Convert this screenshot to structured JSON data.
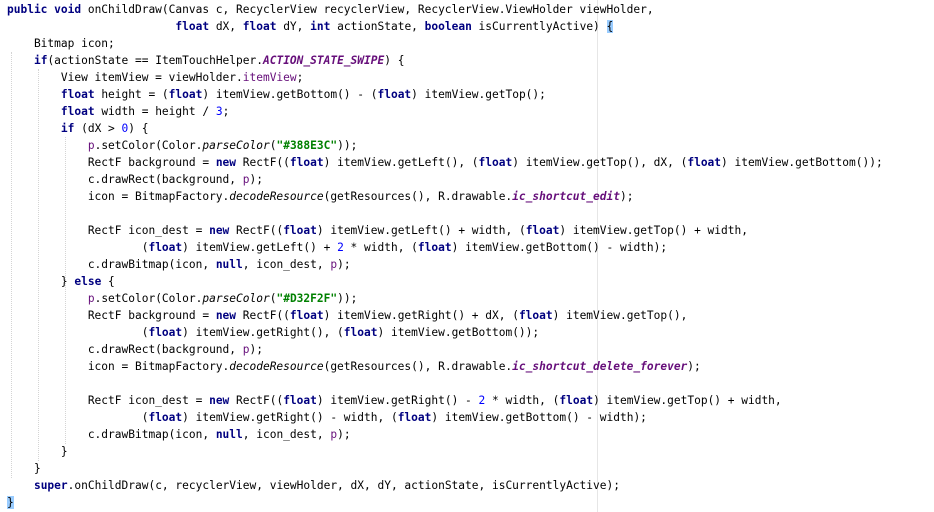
{
  "editor": {
    "colors": {
      "background": "#ffffff",
      "keyword": "#000080",
      "string": "#008000",
      "number": "#0000ff",
      "field": "#660e7a",
      "brace_highlight": "#99ccff",
      "right_margin": "#e6e6e6"
    },
    "lines": [
      [
        {
          "t": "public void",
          "c": "kw"
        },
        {
          "t": " onChildDraw(Canvas c, RecyclerView recyclerView, RecyclerView.ViewHolder viewHolder,",
          "c": "pl"
        }
      ],
      [
        {
          "t": "                         ",
          "c": "pl"
        },
        {
          "t": "float",
          "c": "kw"
        },
        {
          "t": " dX, ",
          "c": "pl"
        },
        {
          "t": "float",
          "c": "kw"
        },
        {
          "t": " dY, ",
          "c": "pl"
        },
        {
          "t": "int",
          "c": "kw"
        },
        {
          "t": " actionState, ",
          "c": "pl"
        },
        {
          "t": "boolean",
          "c": "kw"
        },
        {
          "t": " isCurrentlyActive) ",
          "c": "pl"
        },
        {
          "t": "{",
          "c": "brace-hl"
        }
      ],
      [
        {
          "t": "    Bitmap icon;",
          "c": "pl"
        }
      ],
      [
        {
          "t": "    ",
          "c": "pl"
        },
        {
          "t": "if",
          "c": "kw"
        },
        {
          "t": "(actionState == ItemTouchHelper.",
          "c": "pl"
        },
        {
          "t": "ACTION_STATE_SWIPE",
          "c": "cfld"
        },
        {
          "t": ") {",
          "c": "pl"
        }
      ],
      [
        {
          "t": "        View itemView = viewHolder.",
          "c": "pl"
        },
        {
          "t": "itemView",
          "c": "fld"
        },
        {
          "t": ";",
          "c": "pl"
        }
      ],
      [
        {
          "t": "        ",
          "c": "pl"
        },
        {
          "t": "float",
          "c": "kw"
        },
        {
          "t": " height = (",
          "c": "pl"
        },
        {
          "t": "float",
          "c": "kw"
        },
        {
          "t": ") itemView.getBottom() - (",
          "c": "pl"
        },
        {
          "t": "float",
          "c": "kw"
        },
        {
          "t": ") itemView.getTop();",
          "c": "pl"
        }
      ],
      [
        {
          "t": "        ",
          "c": "pl"
        },
        {
          "t": "float",
          "c": "kw"
        },
        {
          "t": " width = height / ",
          "c": "pl"
        },
        {
          "t": "3",
          "c": "num"
        },
        {
          "t": ";",
          "c": "pl"
        }
      ],
      [
        {
          "t": "        ",
          "c": "pl"
        },
        {
          "t": "if",
          "c": "kw"
        },
        {
          "t": " (dX > ",
          "c": "pl"
        },
        {
          "t": "0",
          "c": "num"
        },
        {
          "t": ") {",
          "c": "pl"
        }
      ],
      [
        {
          "t": "            ",
          "c": "pl"
        },
        {
          "t": "p",
          "c": "fld"
        },
        {
          "t": ".setColor(Color.",
          "c": "pl"
        },
        {
          "t": "parseColor",
          "c": "mth"
        },
        {
          "t": "(",
          "c": "pl"
        },
        {
          "t": "\"#388E3C\"",
          "c": "str"
        },
        {
          "t": "));",
          "c": "pl"
        }
      ],
      [
        {
          "t": "            RectF background = ",
          "c": "pl"
        },
        {
          "t": "new",
          "c": "kw"
        },
        {
          "t": " RectF((",
          "c": "pl"
        },
        {
          "t": "float",
          "c": "kw"
        },
        {
          "t": ") itemView.getLeft(), (",
          "c": "pl"
        },
        {
          "t": "float",
          "c": "kw"
        },
        {
          "t": ") itemView.getTop(), dX, (",
          "c": "pl"
        },
        {
          "t": "float",
          "c": "kw"
        },
        {
          "t": ") itemView.getBottom());",
          "c": "pl"
        }
      ],
      [
        {
          "t": "            c.drawRect(background, ",
          "c": "pl"
        },
        {
          "t": "p",
          "c": "fld"
        },
        {
          "t": ");",
          "c": "pl"
        }
      ],
      [
        {
          "t": "            icon = BitmapFactory.",
          "c": "pl"
        },
        {
          "t": "decodeResource",
          "c": "mth"
        },
        {
          "t": "(getResources(), R.drawable.",
          "c": "pl"
        },
        {
          "t": "ic_shortcut_edit",
          "c": "cfld"
        },
        {
          "t": ");",
          "c": "pl"
        }
      ],
      [
        {
          "t": "",
          "c": "pl"
        }
      ],
      [
        {
          "t": "            RectF icon_dest = ",
          "c": "pl"
        },
        {
          "t": "new",
          "c": "kw"
        },
        {
          "t": " RectF((",
          "c": "pl"
        },
        {
          "t": "float",
          "c": "kw"
        },
        {
          "t": ") itemView.getLeft() + width, (",
          "c": "pl"
        },
        {
          "t": "float",
          "c": "kw"
        },
        {
          "t": ") itemView.getTop() + width,",
          "c": "pl"
        }
      ],
      [
        {
          "t": "                    (",
          "c": "pl"
        },
        {
          "t": "float",
          "c": "kw"
        },
        {
          "t": ") itemView.getLeft() + ",
          "c": "pl"
        },
        {
          "t": "2",
          "c": "num"
        },
        {
          "t": " * width, (",
          "c": "pl"
        },
        {
          "t": "float",
          "c": "kw"
        },
        {
          "t": ") itemView.getBottom() - width);",
          "c": "pl"
        }
      ],
      [
        {
          "t": "            c.drawBitmap(icon, ",
          "c": "pl"
        },
        {
          "t": "null",
          "c": "kw"
        },
        {
          "t": ", icon_dest, ",
          "c": "pl"
        },
        {
          "t": "p",
          "c": "fld"
        },
        {
          "t": ");",
          "c": "pl"
        }
      ],
      [
        {
          "t": "        } ",
          "c": "pl"
        },
        {
          "t": "else",
          "c": "kw"
        },
        {
          "t": " {",
          "c": "pl"
        }
      ],
      [
        {
          "t": "            ",
          "c": "pl"
        },
        {
          "t": "p",
          "c": "fld"
        },
        {
          "t": ".setColor(Color.",
          "c": "pl"
        },
        {
          "t": "parseColor",
          "c": "mth"
        },
        {
          "t": "(",
          "c": "pl"
        },
        {
          "t": "\"#D32F2F\"",
          "c": "str"
        },
        {
          "t": "));",
          "c": "pl"
        }
      ],
      [
        {
          "t": "            RectF background = ",
          "c": "pl"
        },
        {
          "t": "new",
          "c": "kw"
        },
        {
          "t": " RectF((",
          "c": "pl"
        },
        {
          "t": "float",
          "c": "kw"
        },
        {
          "t": ") itemView.getRight() + dX, (",
          "c": "pl"
        },
        {
          "t": "float",
          "c": "kw"
        },
        {
          "t": ") itemView.getTop(),",
          "c": "pl"
        }
      ],
      [
        {
          "t": "                    (",
          "c": "pl"
        },
        {
          "t": "float",
          "c": "kw"
        },
        {
          "t": ") itemView.getRight(), (",
          "c": "pl"
        },
        {
          "t": "float",
          "c": "kw"
        },
        {
          "t": ") itemView.getBottom());",
          "c": "pl"
        }
      ],
      [
        {
          "t": "            c.drawRect(background, ",
          "c": "pl"
        },
        {
          "t": "p",
          "c": "fld"
        },
        {
          "t": ");",
          "c": "pl"
        }
      ],
      [
        {
          "t": "            icon = BitmapFactory.",
          "c": "pl"
        },
        {
          "t": "decodeResource",
          "c": "mth"
        },
        {
          "t": "(getResources(), R.drawable.",
          "c": "pl"
        },
        {
          "t": "ic_shortcut_delete_forever",
          "c": "cfld"
        },
        {
          "t": ");",
          "c": "pl"
        }
      ],
      [
        {
          "t": "",
          "c": "pl"
        }
      ],
      [
        {
          "t": "            RectF icon_dest = ",
          "c": "pl"
        },
        {
          "t": "new",
          "c": "kw"
        },
        {
          "t": " RectF((",
          "c": "pl"
        },
        {
          "t": "float",
          "c": "kw"
        },
        {
          "t": ") itemView.getRight() - ",
          "c": "pl"
        },
        {
          "t": "2",
          "c": "num"
        },
        {
          "t": " * width, (",
          "c": "pl"
        },
        {
          "t": "float",
          "c": "kw"
        },
        {
          "t": ") itemView.getTop() + width,",
          "c": "pl"
        }
      ],
      [
        {
          "t": "                    (",
          "c": "pl"
        },
        {
          "t": "float",
          "c": "kw"
        },
        {
          "t": ") itemView.getRight() - width, (",
          "c": "pl"
        },
        {
          "t": "float",
          "c": "kw"
        },
        {
          "t": ") itemView.getBottom() - width);",
          "c": "pl"
        }
      ],
      [
        {
          "t": "            c.drawBitmap(icon, ",
          "c": "pl"
        },
        {
          "t": "null",
          "c": "kw"
        },
        {
          "t": ", icon_dest, ",
          "c": "pl"
        },
        {
          "t": "p",
          "c": "fld"
        },
        {
          "t": ");",
          "c": "pl"
        }
      ],
      [
        {
          "t": "        }",
          "c": "pl"
        }
      ],
      [
        {
          "t": "    }",
          "c": "pl"
        }
      ],
      [
        {
          "t": "    ",
          "c": "pl"
        },
        {
          "t": "super",
          "c": "kw"
        },
        {
          "t": ".onChildDraw(c, recyclerView, viewHolder, dX, dY, actionState, isCurrentlyActive);",
          "c": "pl"
        }
      ],
      [
        {
          "t": "}",
          "c": "brace-hl"
        }
      ]
    ]
  }
}
